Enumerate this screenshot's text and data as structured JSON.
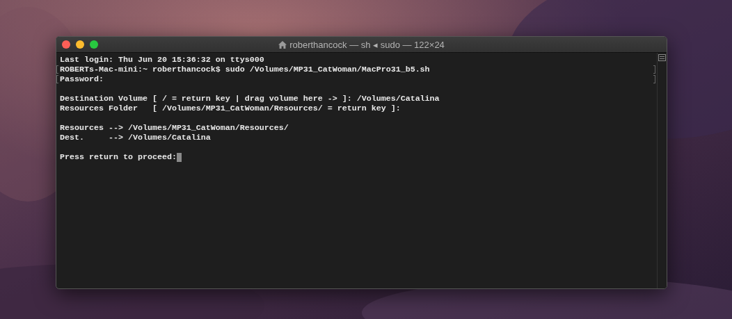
{
  "window": {
    "title": "roberthancock — sh ◂ sudo — 122×24"
  },
  "blocks": [
    {
      "lines": [
        {
          "text": "Last login: Thu Jun 20 15:36:32 on ttys000",
          "marked": false,
          "cursor": false
        },
        {
          "text": "ROBERTs-Mac-mini:~ roberthancock$ sudo /Volumes/MP31_CatWoman/MacPro31_b5.sh",
          "marked": true,
          "cursor": false
        },
        {
          "text": "Password:",
          "marked": true,
          "cursor": false
        }
      ]
    },
    {
      "lines": [
        {
          "text": "Destination Volume [ / = return key | drag volume here -> ]: /Volumes/Catalina",
          "marked": false,
          "cursor": false
        },
        {
          "text": "Resources Folder   [ /Volumes/MP31_CatWoman/Resources/ = return key ]:",
          "marked": false,
          "cursor": false
        }
      ]
    },
    {
      "lines": [
        {
          "text": "Resources --> /Volumes/MP31_CatWoman/Resources/",
          "marked": false,
          "cursor": false
        },
        {
          "text": "Dest.     --> /Volumes/Catalina",
          "marked": false,
          "cursor": false
        }
      ]
    },
    {
      "lines": [
        {
          "text": "Press return to proceed:",
          "marked": false,
          "cursor": true
        }
      ]
    }
  ]
}
